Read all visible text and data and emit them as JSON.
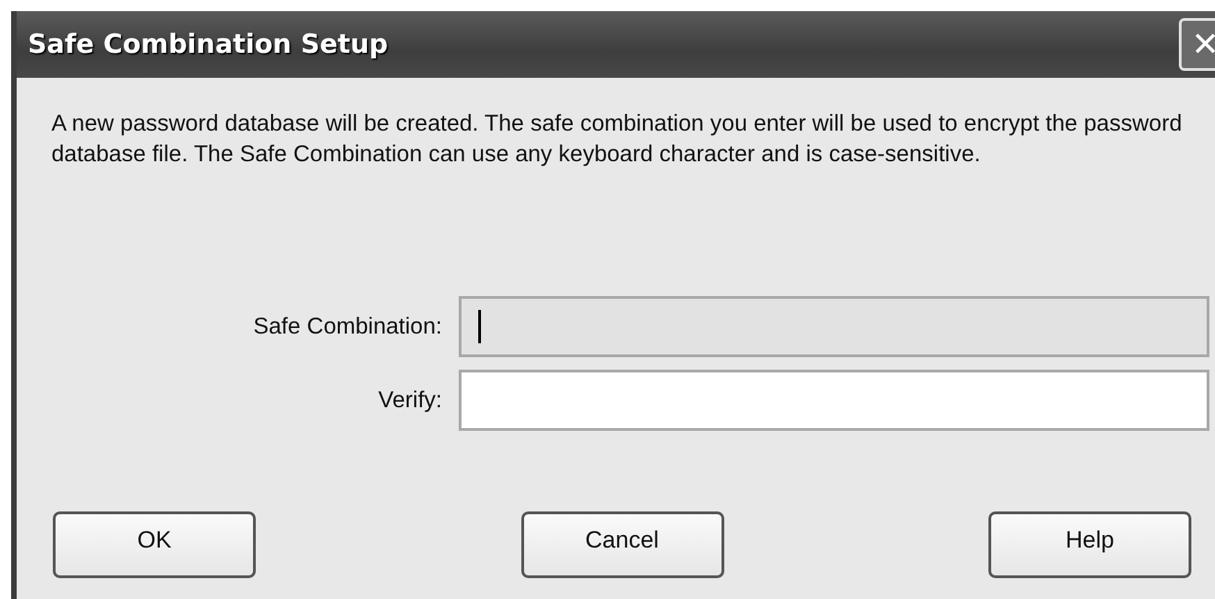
{
  "window": {
    "title": "Safe Combination Setup",
    "close": "✕"
  },
  "message": "A new password database will be created. The safe combination you enter will be used to encrypt the password database file. The Safe Combination can use any keyboard character and is case-sensitive.",
  "fields": [
    {
      "label": "Safe Combination:",
      "focused": true
    },
    {
      "label": "Verify:",
      "focused": false
    }
  ],
  "buttons": [
    "OK",
    "Cancel",
    "Help"
  ]
}
